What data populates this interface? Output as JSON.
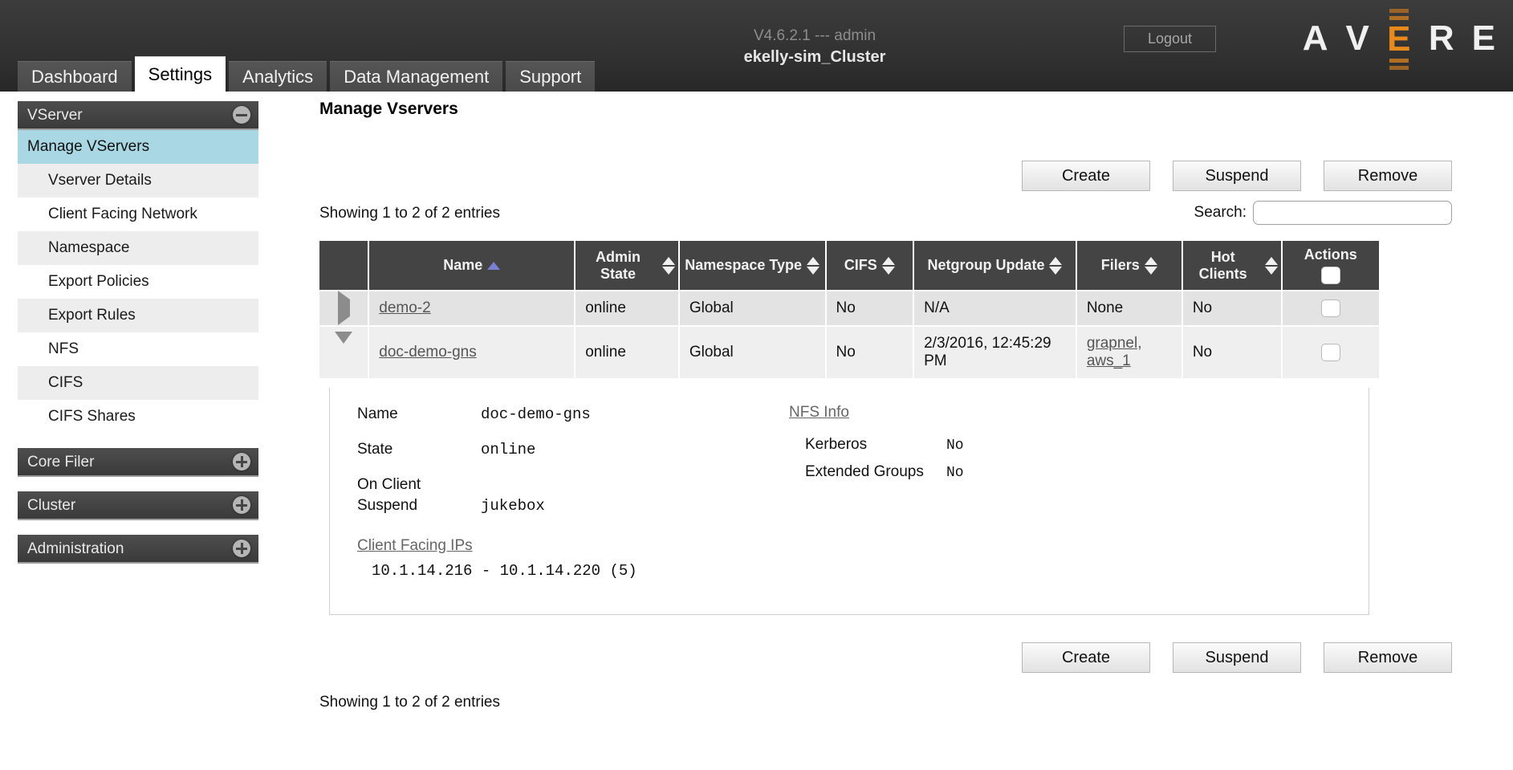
{
  "header": {
    "logout_label": "Logout",
    "version_line": "V4.6.2.1 --- admin",
    "cluster_name": "ekelly-sim_Cluster",
    "brand": {
      "letters": [
        "A",
        "V",
        "E",
        "R",
        "E"
      ],
      "accent_color": "#e8891c",
      "text_color": "#f0f0f0"
    },
    "tabs": [
      {
        "label": "Dashboard",
        "active": false
      },
      {
        "label": "Settings",
        "active": true
      },
      {
        "label": "Analytics",
        "active": false
      },
      {
        "label": "Data Management",
        "active": false
      },
      {
        "label": "Support",
        "active": false
      }
    ]
  },
  "sidebar": {
    "sections": [
      {
        "title": "VServer",
        "expanded": true,
        "toggle_icon": "minus-circle-icon",
        "items": [
          {
            "label": "Manage VServers",
            "selected": true
          },
          {
            "label": "Vserver Details",
            "selected": false
          },
          {
            "label": "Client Facing Network",
            "selected": false
          },
          {
            "label": "Namespace",
            "selected": false
          },
          {
            "label": "Export Policies",
            "selected": false
          },
          {
            "label": "Export Rules",
            "selected": false
          },
          {
            "label": "NFS",
            "selected": false
          },
          {
            "label": "CIFS",
            "selected": false
          },
          {
            "label": "CIFS Shares",
            "selected": false
          }
        ]
      },
      {
        "title": "Core Filer",
        "expanded": false,
        "toggle_icon": "plus-circle-icon",
        "items": []
      },
      {
        "title": "Cluster",
        "expanded": false,
        "toggle_icon": "plus-circle-icon",
        "items": []
      },
      {
        "title": "Administration",
        "expanded": false,
        "toggle_icon": "plus-circle-icon",
        "items": []
      }
    ]
  },
  "main": {
    "page_title": "Manage Vservers",
    "actions": {
      "create_label": "Create",
      "suspend_label": "Suspend",
      "remove_label": "Remove"
    },
    "table_info_top": "Showing 1 to 2 of 2 entries",
    "table_info_bottom": "Showing 1 to 2 of 2 entries",
    "search": {
      "label": "Search:",
      "value": "",
      "placeholder": ""
    },
    "table": {
      "columns": [
        {
          "label": "",
          "sort": "none",
          "key": "expander"
        },
        {
          "label": "Name",
          "sort": "asc",
          "key": "name"
        },
        {
          "label": "Admin State",
          "sort": "both",
          "key": "admin_state"
        },
        {
          "label": "Namespace Type",
          "sort": "both",
          "key": "namespace_type"
        },
        {
          "label": "CIFS",
          "sort": "both",
          "key": "cifs"
        },
        {
          "label": "Netgroup Update",
          "sort": "both",
          "key": "netgroup_update"
        },
        {
          "label": "Filers",
          "sort": "both",
          "key": "filers"
        },
        {
          "label": "Hot Clients",
          "sort": "both",
          "key": "hot_clients"
        },
        {
          "label": "Actions",
          "sort": "none",
          "key": "actions"
        }
      ],
      "header_select_all_checked": false,
      "rows": [
        {
          "expanded": false,
          "name": "demo-2",
          "admin_state": "online",
          "namespace_type": "Global",
          "cifs": "No",
          "netgroup_update": "N/A",
          "filers": [
            "None"
          ],
          "filers_are_links": false,
          "hot_clients": "No",
          "checked": false
        },
        {
          "expanded": true,
          "name": "doc-demo-gns",
          "admin_state": "online",
          "namespace_type": "Global",
          "cifs": "No",
          "netgroup_update": "2/3/2016, 12:45:29 PM",
          "filers": [
            "grapnel,",
            "aws_1"
          ],
          "filers_are_links": true,
          "hot_clients": "No",
          "checked": false,
          "detail": {
            "left": {
              "fields": [
                {
                  "label": "Name",
                  "value": "doc-demo-gns"
                },
                {
                  "label": "State",
                  "value": "online"
                },
                {
                  "label": "On Client Suspend",
                  "value": "jukebox"
                }
              ],
              "client_facing_ips_title": "Client Facing IPs",
              "client_facing_ips": "10.1.14.216 - 10.1.14.220 (5)"
            },
            "right": {
              "nfs_info_title": "NFS Info",
              "fields": [
                {
                  "label": "Kerberos",
                  "value": "No"
                },
                {
                  "label": "Extended Groups",
                  "value": "No"
                }
              ]
            }
          }
        }
      ]
    }
  }
}
